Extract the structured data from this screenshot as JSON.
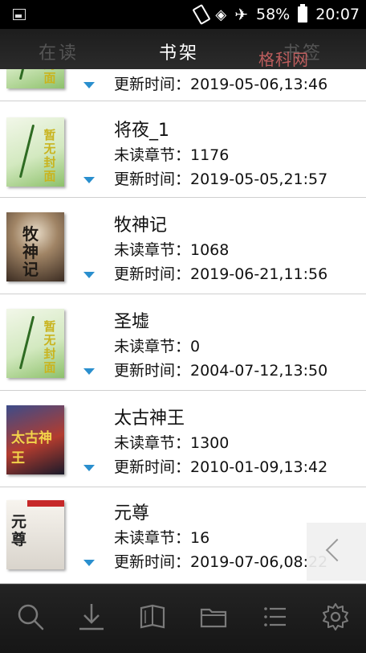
{
  "status_bar": {
    "battery": "58%",
    "time": "20:07"
  },
  "tabs": [
    {
      "label": "在读",
      "active": false
    },
    {
      "label": "书架",
      "active": true
    },
    {
      "label": "书签",
      "active": false
    }
  ],
  "watermark": "格科网",
  "cover_labels": {
    "default": "暂无封面",
    "mushenji": "牧神记",
    "taigu": "太古神王",
    "yuanzun": "元尊"
  },
  "books": [
    {
      "title": "",
      "unread": "",
      "updated": "更新时间：2019-05-06,13:46",
      "cover": "default"
    },
    {
      "title": "将夜_1",
      "unread": "未读章节：1176",
      "updated": "更新时间：2019-05-05,21:57",
      "cover": "default"
    },
    {
      "title": "牧神记",
      "unread": "未读章节：1068",
      "updated": "更新时间：2019-06-21,11:56",
      "cover": "mushenji"
    },
    {
      "title": "圣墟",
      "unread": "未读章节：0",
      "updated": "更新时间：2004-07-12,13:50",
      "cover": "default"
    },
    {
      "title": "太古神王",
      "unread": "未读章节：1300",
      "updated": "更新时间：2010-01-09,13:42",
      "cover": "taigu"
    },
    {
      "title": "元尊",
      "unread": "未读章节：16",
      "updated": "更新时间：2019-07-06,08:22",
      "cover": "yuanzun"
    }
  ],
  "toolbar": [
    {
      "icon": "search-icon"
    },
    {
      "icon": "download-icon"
    },
    {
      "icon": "book-icon"
    },
    {
      "icon": "folder-icon"
    },
    {
      "icon": "list-icon"
    },
    {
      "icon": "gear-icon"
    }
  ],
  "colors": {
    "accent_arrow": "#2a8fce",
    "header_bg": "#1d1d1d",
    "watermark": "#e36b6b"
  }
}
